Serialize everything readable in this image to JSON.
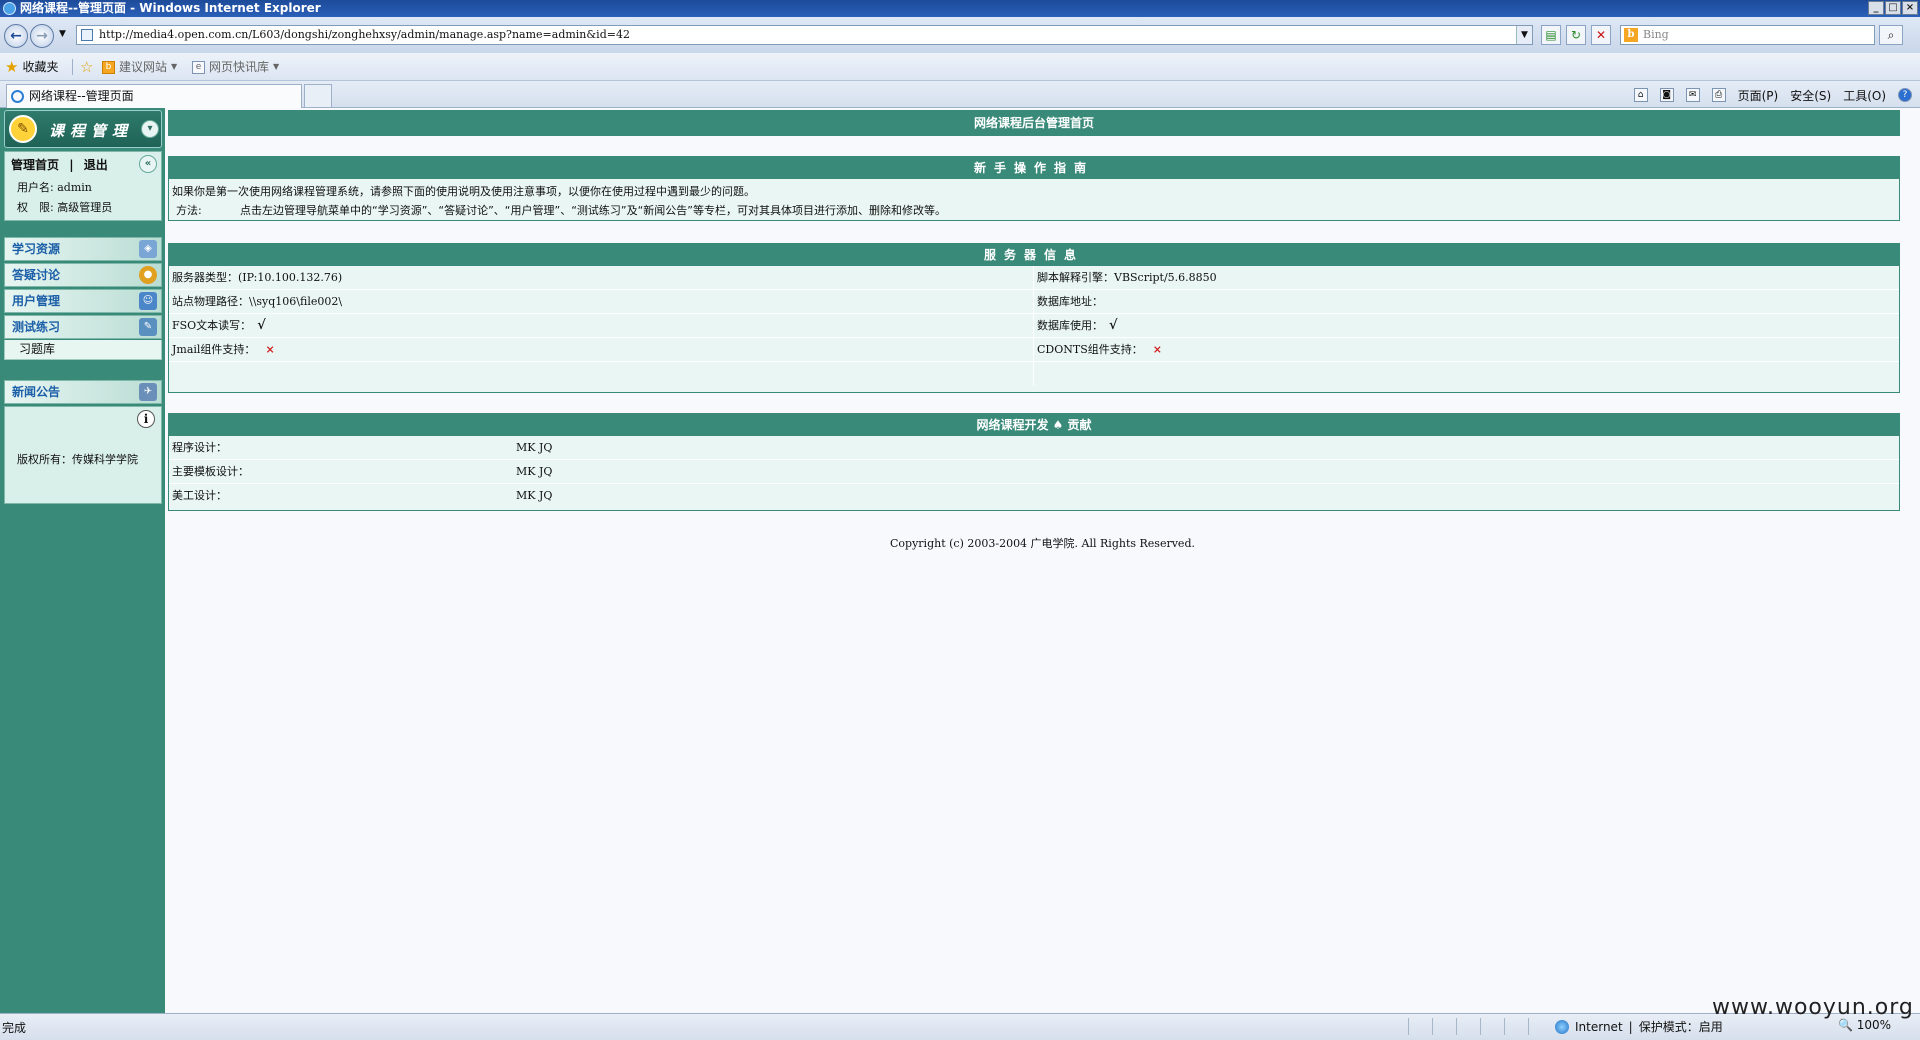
{
  "window": {
    "title": "网络课程--管理页面 - Windows Internet Explorer"
  },
  "browser": {
    "address": "http://media4.open.com.cn/L603/dongshi/zonghehxsy/admin/manage.asp?name=admin&id=42",
    "search_placeholder": "Bing",
    "favorites": {
      "favorites_label": "收藏夹",
      "suggested_sites": "建议网站",
      "web_slice": "网页快讯库"
    },
    "tab_title": "网络课程--管理页面",
    "commands": {
      "page": "页面(P)",
      "safety": "安全(S)",
      "tools": "工具(O)"
    }
  },
  "sidebar": {
    "title": "课程管理",
    "links": {
      "home": "管理首页",
      "separator": "|",
      "logout": "退出"
    },
    "user_label": "用户名:",
    "user_value": "admin",
    "role_label": "权　限:",
    "role_value": "高级管理员",
    "menu": [
      {
        "label": "学习资源"
      },
      {
        "label": "答疑讨论"
      },
      {
        "label": "用户管理"
      },
      {
        "label": "测试练习"
      }
    ],
    "submenu_exercise": "习题库",
    "news": "新闻公告",
    "copyright": "版权所有：传媒科学学院"
  },
  "main": {
    "top_title": "网络课程后台管理首页",
    "guide": {
      "title": "新手操作指南",
      "line1": "如果你是第一次使用网络课程管理系统，请参照下面的使用说明及使用注意事项，以便你在使用过程中遇到最少的问题。",
      "method_label": "方法:",
      "method_text": "点击左边管理导航菜单中的“学习资源”、“答疑讨论”、“用户管理”、“测试练习”及“新闻公告”等专栏，可对其具体项目进行添加、删除和修改等。"
    },
    "server": {
      "title": "服务器信息",
      "server_type": "服务器类型：(IP:10.100.132.76)",
      "script_engine": "脚本解释引擎：VBScript/5.6.8850",
      "physical_path": "站点物理路径：\\\\syq106\\file002\\",
      "db_address": "数据库地址：",
      "fso_label": "FSO文本读写：",
      "fso_value": "√",
      "db_use_label": "数据库使用：",
      "db_use_value": "√",
      "jmail_label": "Jmail组件支持：",
      "jmail_value": "×",
      "cdonts_label": "CDONTS组件支持：",
      "cdonts_value": "×"
    },
    "dev": {
      "title": "网络课程开发 ♠ 贡献",
      "rows": [
        {
          "label": "程序设计：",
          "value": "MK JQ"
        },
        {
          "label": "主要模板设计：",
          "value": "MK JQ"
        },
        {
          "label": "美工设计：",
          "value": "MK JQ"
        }
      ]
    },
    "copyright": "Copyright (c) 2003-2004 广电学院. All Rights Reserved."
  },
  "status": {
    "text": "完成",
    "zone": "Internet",
    "protected_mode": "保护模式：启用",
    "zoom": "100%"
  },
  "watermark": "www.wooyun.org"
}
